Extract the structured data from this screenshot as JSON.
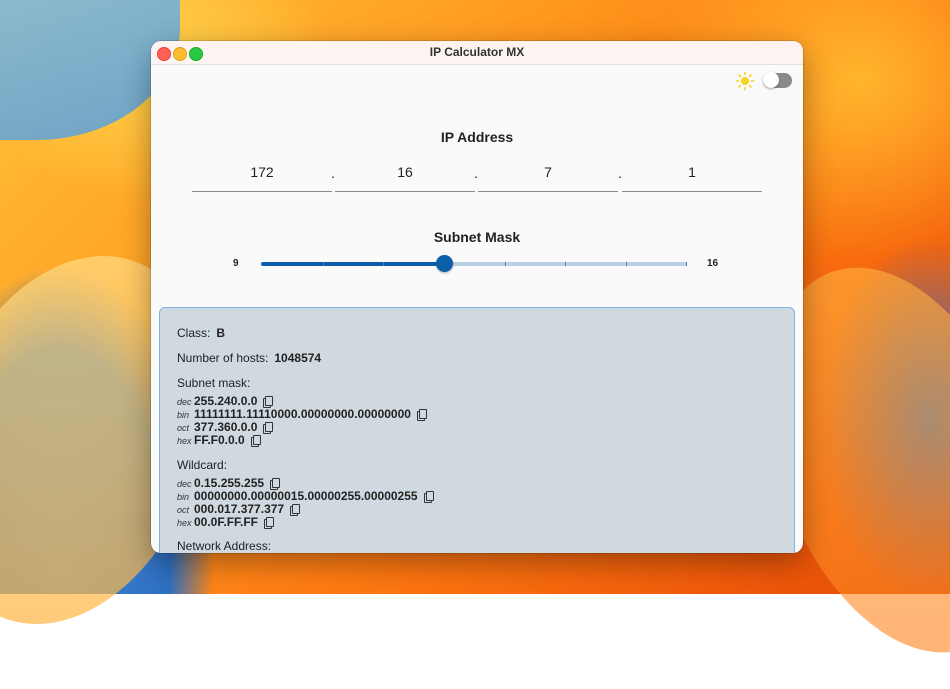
{
  "window": {
    "title": "IP Calculator MX"
  },
  "theme": {
    "light_icon": "sun-icon",
    "dark_mode": false
  },
  "ip": {
    "title": "IP Address",
    "octets": [
      "172",
      "16",
      "7",
      "1"
    ],
    "separator": "."
  },
  "subnet": {
    "title": "Subnet Mask",
    "min_label": "9",
    "max_label": "16",
    "value_fraction": 0.43
  },
  "results": {
    "class_label": "Class:",
    "class_value": "B",
    "hosts_label": "Number of hosts:",
    "hosts_value": "1048574",
    "mask_label": "Subnet mask:",
    "mask": [
      {
        "tag": "dec",
        "value": "255.240.0.0"
      },
      {
        "tag": "bin",
        "value": "11111111.11110000.00000000.00000000"
      },
      {
        "tag": "oct",
        "value": "377.360.0.0"
      },
      {
        "tag": "hex",
        "value": "FF.F0.0.0"
      }
    ],
    "wildcard_label": "Wildcard:",
    "wildcard": [
      {
        "tag": "dec",
        "value": "0.15.255.255"
      },
      {
        "tag": "bin",
        "value": "00000000.00000015.00000255.00000255"
      },
      {
        "tag": "oct",
        "value": "000.017.377.377"
      },
      {
        "tag": "hex",
        "value": "00.0F.FF.FF"
      }
    ],
    "network_label": "Network Address:"
  },
  "colors": {
    "accent": "#0b5fa8",
    "panel": "#d0d9df",
    "panel_border": "#7fb2e5"
  }
}
